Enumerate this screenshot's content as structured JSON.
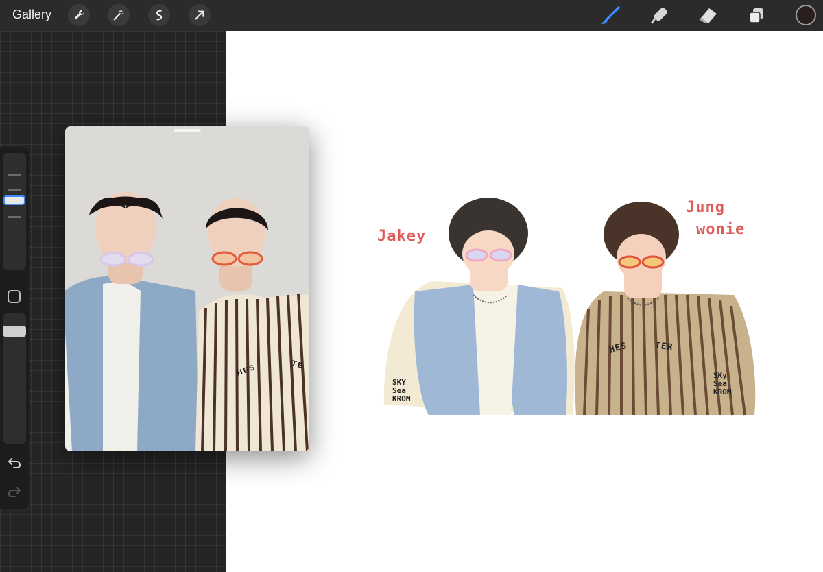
{
  "toolbar": {
    "gallery_label": "Gallery",
    "left_tools": [
      "wrench-icon",
      "magic-wand-icon",
      "selection-icon",
      "transform-arrow-icon"
    ],
    "right_tools": [
      "brush-icon",
      "smudge-icon",
      "eraser-icon",
      "layers-icon"
    ],
    "current_color": "#2a1f1c",
    "accent": "#3e8bff"
  },
  "sidebar": {
    "brush_size_level": 0.45,
    "opacity_level": 0.9
  },
  "artwork": {
    "label_left": "Jakey",
    "label_right_line1": "Jung",
    "label_right_line2": "wonie",
    "watermark_left": [
      "SKY",
      "Sea",
      "KROM"
    ],
    "watermark_right": [
      "SKy",
      "Sea",
      "KROM"
    ],
    "shirt_text_left": "HES",
    "shirt_text_right": "TER"
  },
  "reference_photo": {
    "shirt_text_a": "HES",
    "shirt_text_b": "TE"
  }
}
